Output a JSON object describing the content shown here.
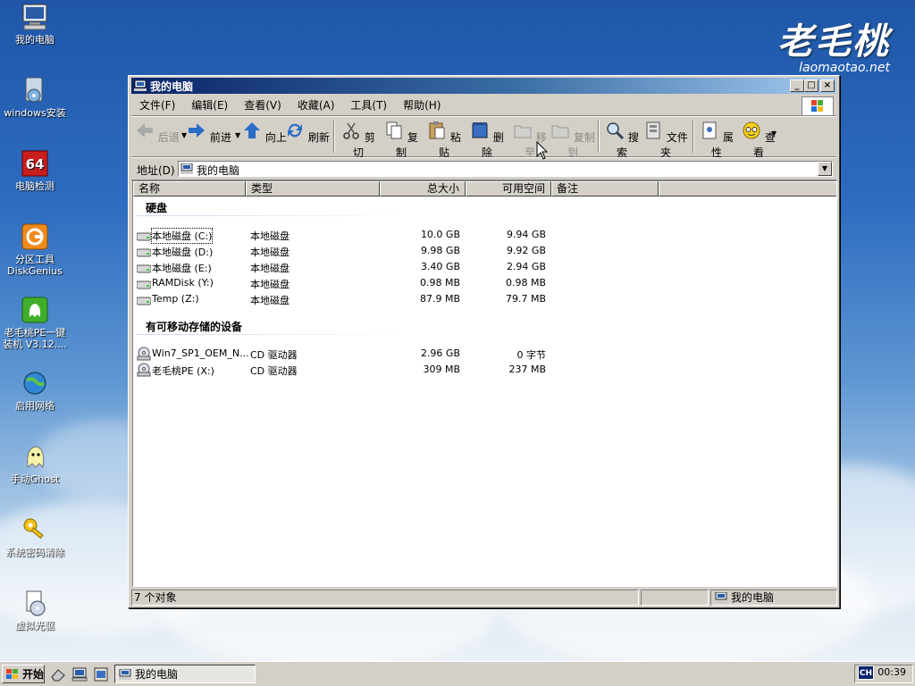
{
  "desktop": {
    "icons": [
      {
        "label": "我的电脑",
        "icon": "computer-icon"
      },
      {
        "label": "windows安装",
        "icon": "installer-icon"
      },
      {
        "label": "电脑检测",
        "icon": "test-64-icon"
      },
      {
        "label": "分区工具\nDiskGenius",
        "icon": "diskgenius-icon"
      },
      {
        "label": "老毛桃PE一键\n装机 V3.12....",
        "icon": "installer-ghost-icon"
      },
      {
        "label": "启用网络",
        "icon": "network-globe-icon"
      },
      {
        "label": "手动Ghost",
        "icon": "ghost-icon"
      },
      {
        "label": "系统密码清除",
        "icon": "key-icon"
      },
      {
        "label": "虚拟光驱",
        "icon": "virtual-drive-icon"
      }
    ],
    "logo": {
      "cn": "老毛桃",
      "url": "laomaotao.net"
    }
  },
  "window": {
    "title": "我的电脑",
    "menu": [
      "文件(F)",
      "编辑(E)",
      "查看(V)",
      "收藏(A)",
      "工具(T)",
      "帮助(H)"
    ],
    "toolbar": {
      "back": "后退",
      "forward": "前进",
      "up": "向上",
      "refresh": "刷新",
      "cut": "剪切",
      "copy": "复制",
      "paste": "粘贴",
      "delete": "删除",
      "move_to": "移至",
      "copy_to": "复制到",
      "search": "搜索",
      "folders": "文件夹",
      "properties": "属性",
      "view": "查看"
    },
    "address": {
      "label": "地址(D)",
      "value": "我的电脑"
    },
    "columns": [
      "名称",
      "类型",
      "总大小",
      "可用空间",
      "备注"
    ],
    "groups": {
      "hard_disks": {
        "title": "硬盘",
        "rows": [
          {
            "name": "本地磁盘 (C:)",
            "type": "本地磁盘",
            "total": "10.0 GB",
            "free": "9.94 GB"
          },
          {
            "name": "本地磁盘 (D:)",
            "type": "本地磁盘",
            "total": "9.98 GB",
            "free": "9.92 GB"
          },
          {
            "name": "本地磁盘 (E:)",
            "type": "本地磁盘",
            "total": "3.40 GB",
            "free": "2.94 GB"
          },
          {
            "name": "RAMDisk (Y:)",
            "type": "本地磁盘",
            "total": "0.98 MB",
            "free": "0.98 MB"
          },
          {
            "name": "Temp (Z:)",
            "type": "本地磁盘",
            "total": "87.9 MB",
            "free": "79.7 MB"
          }
        ]
      },
      "removable": {
        "title": "有可移动存储的设备",
        "rows": [
          {
            "name": "Win7_SP1_OEM_N...",
            "type": "CD 驱动器",
            "total": "2.96 GB",
            "free": "0 字节"
          },
          {
            "name": "老毛桃PE (X:)",
            "type": "CD 驱动器",
            "total": "309 MB",
            "free": "237 MB"
          }
        ]
      }
    },
    "status": {
      "count": "7 个对象",
      "location": "我的电脑"
    }
  },
  "taskbar": {
    "start": "开始",
    "task": "我的电脑",
    "ime": "CH",
    "clock": "00:39"
  }
}
